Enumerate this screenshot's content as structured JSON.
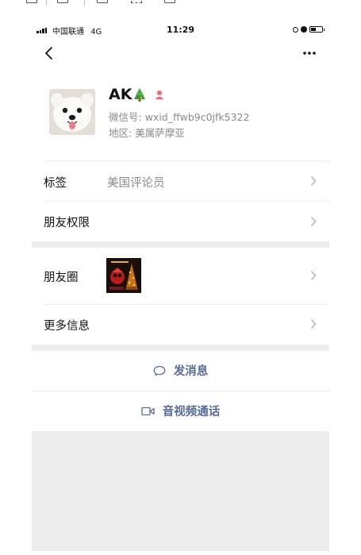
{
  "status_bar": {
    "carrier": "中国联通",
    "network": "4G",
    "time": "11:29"
  },
  "profile": {
    "name": "AK",
    "name_emoji": "christmas-tree",
    "wechat_id_label": "微信号:",
    "wechat_id": "wxid_ffwb9c0jfk5322",
    "region_label": "地区:",
    "region": "美属萨摩亚"
  },
  "rows": {
    "tags": {
      "label": "标签",
      "value": "美国评论员"
    },
    "friend_permissions": {
      "label": "朋友权限"
    },
    "moments": {
      "label": "朋友圈"
    },
    "more_info": {
      "label": "更多信息"
    }
  },
  "actions": {
    "send_message": "发消息",
    "video_call": "音视频通话"
  },
  "colors": {
    "link": "#576b95",
    "separator": "#ededed",
    "secondary_text": "#8a8a8a",
    "gender_icon": "#f06a6a"
  },
  "icons": [
    "back-icon",
    "more-icon",
    "chevron-right-icon",
    "chat-bubble-icon",
    "video-camera-icon",
    "signal-icon",
    "battery-icon"
  ]
}
